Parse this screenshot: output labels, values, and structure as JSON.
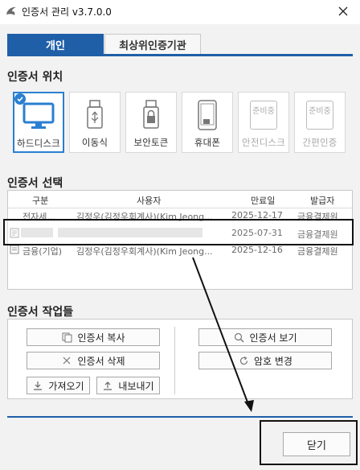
{
  "window": {
    "title": "인증서 관리 v3.7.0.0"
  },
  "tabs": [
    {
      "label": "개인",
      "active": true
    },
    {
      "label": "최상위인증기관",
      "active": false
    }
  ],
  "location": {
    "title": "인증서 위치",
    "tiles": [
      {
        "label": "하드디스크",
        "icon": "monitor-icon",
        "selected": true,
        "enabled": true
      },
      {
        "label": "이동식",
        "icon": "usb-icon",
        "selected": false,
        "enabled": true
      },
      {
        "label": "보안토큰",
        "icon": "lock-token-icon",
        "selected": false,
        "enabled": true
      },
      {
        "label": "휴대폰",
        "icon": "phone-icon",
        "selected": false,
        "enabled": true
      },
      {
        "label": "안전디스크",
        "icon": "preparing-badge-icon",
        "badge": "준비중",
        "selected": false,
        "enabled": false
      },
      {
        "label": "간편인증",
        "icon": "preparing-badge-icon",
        "badge": "준비중",
        "selected": false,
        "enabled": false
      }
    ]
  },
  "selection": {
    "title": "인증서 선택",
    "columns": [
      "구분",
      "사용자",
      "만료일",
      "발급자"
    ],
    "rows": [
      {
        "type": "전자세...",
        "user": "김정우(김정우회계사)(Kim Jeong...",
        "expiry": "2025-12-17",
        "issuer": "금융결제원"
      },
      {
        "type": "",
        "user": "",
        "expiry": "2025-07-31",
        "issuer": "금융결제원"
      },
      {
        "type": "금융(기업)",
        "user": "김정우(김정우회계사)(Kim Jeong...",
        "expiry": "2025-12-16",
        "issuer": "금융결제원"
      }
    ]
  },
  "tasks": {
    "title": "인증서 작업들",
    "copy": "인증서 복사",
    "delete": "인증서 삭제",
    "import": "가져오기",
    "export": "내보내기",
    "view": "인증서 보기",
    "change_password": "암호 변경"
  },
  "footer": {
    "close": "닫기"
  },
  "colors": {
    "accent": "#1f5fa8",
    "selected_border": "#2a7fd0",
    "annotation": "#111111"
  }
}
